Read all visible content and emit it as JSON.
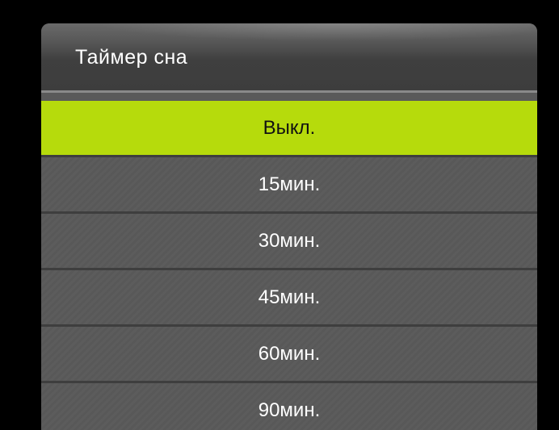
{
  "dialog": {
    "title": "Таймер сна",
    "options": [
      "Выкл.",
      "15мин.",
      "30мин.",
      "45мин.",
      "60мин.",
      "90мин."
    ],
    "selected": "Выкл."
  },
  "colors": {
    "background": "#000000",
    "panel": "#5a5a5a",
    "header": "#3f3f3f",
    "highlight": "#b6db0c"
  }
}
